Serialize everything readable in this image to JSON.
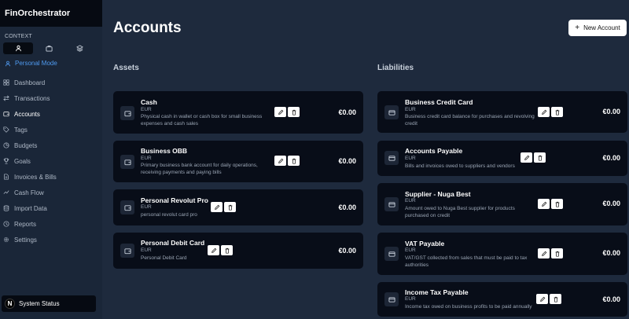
{
  "app": {
    "brand": "FinOrchestrator"
  },
  "sidebar": {
    "context_label": "CONTEXT",
    "context_options": [
      "person-icon",
      "briefcase-icon",
      "layers-icon"
    ],
    "mode_label": "Personal Mode",
    "items": [
      {
        "label": "Dashboard",
        "icon": "grid-icon"
      },
      {
        "label": "Transactions",
        "icon": "arrows-icon"
      },
      {
        "label": "Accounts",
        "icon": "wallet-icon",
        "active": true
      },
      {
        "label": "Tags",
        "icon": "tag-icon"
      },
      {
        "label": "Budgets",
        "icon": "pie-icon"
      },
      {
        "label": "Goals",
        "icon": "trophy-icon"
      },
      {
        "label": "Invoices & Bills",
        "icon": "document-icon"
      },
      {
        "label": "Cash Flow",
        "icon": "flow-icon"
      },
      {
        "label": "Import Data",
        "icon": "database-icon"
      },
      {
        "label": "Reports",
        "icon": "clock-icon"
      },
      {
        "label": "Settings",
        "icon": "gear-icon"
      }
    ],
    "status": {
      "badge": "N",
      "label": "System Status"
    }
  },
  "main": {
    "title": "Accounts",
    "new_button": "New Account",
    "assets_title": "Assets",
    "liabilities_title": "Liabilities",
    "assets": [
      {
        "name": "Cash",
        "currency": "EUR",
        "description": "Physical cash in wallet or cash box for small business expenses and cash sales",
        "amount": "€0.00"
      },
      {
        "name": "Business OBB",
        "currency": "EUR",
        "description": "Primary business bank account for daily operations, receiving payments and paying bills",
        "amount": "€0.00"
      },
      {
        "name": "Personal Revolut Pro",
        "currency": "EUR",
        "description": "personal revolut card pro",
        "amount": "€0.00"
      },
      {
        "name": "Personal Debit Card",
        "currency": "EUR",
        "description": "Personal Debit Card",
        "amount": "€0.00"
      }
    ],
    "liabilities": [
      {
        "name": "Business Credit Card",
        "currency": "EUR",
        "description": "Business credit card balance for purchases and revolving credit",
        "amount": "€0.00"
      },
      {
        "name": "Accounts Payable",
        "currency": "EUR",
        "description": "Bills and invoices owed to suppliers and vendors",
        "amount": "€0.00"
      },
      {
        "name": "Supplier - Nuga Best",
        "currency": "EUR",
        "description": "Amount owed to Nuga Best supplier for products purchased on credit",
        "amount": "€0.00"
      },
      {
        "name": "VAT Payable",
        "currency": "EUR",
        "description": "VAT/GST collected from sales that must be paid to tax authorities",
        "amount": "€0.00"
      },
      {
        "name": "Income Tax Payable",
        "currency": "EUR",
        "description": "Income tax owed on business profits to be paid annually",
        "amount": "€0.00"
      }
    ]
  }
}
